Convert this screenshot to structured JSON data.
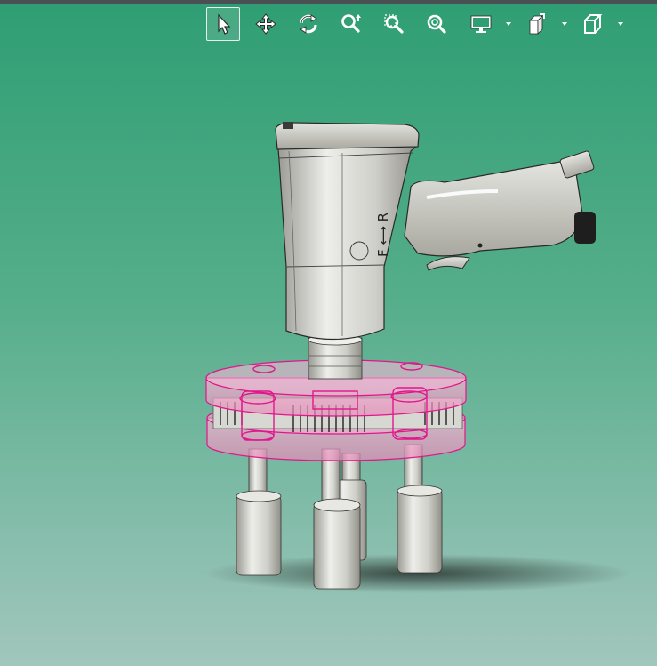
{
  "toolbar": {
    "tools": [
      {
        "name": "select",
        "icon": "select-arrow-icon",
        "active": true
      },
      {
        "name": "pan",
        "icon": "pan-arrows-icon",
        "active": false
      },
      {
        "name": "rotate",
        "icon": "rotate-icon",
        "active": false
      },
      {
        "name": "zoom-dynamic",
        "icon": "zoom-dynamic-icon",
        "active": false
      },
      {
        "name": "zoom-window",
        "icon": "zoom-window-icon",
        "active": false
      },
      {
        "name": "zoom-fit",
        "icon": "zoom-fit-icon",
        "active": false
      },
      {
        "name": "display-mode",
        "icon": "monitor-icon",
        "has_dropdown": true
      },
      {
        "name": "view-orientation",
        "icon": "view-cube-stack-icon",
        "has_dropdown": true
      },
      {
        "name": "view-cube",
        "icon": "cube-icon",
        "has_dropdown": true
      }
    ]
  },
  "viewport": {
    "model_label": "F ⟷ R",
    "background_top": "#2f9e73",
    "background_bottom": "#a2c6bd",
    "highlight_color": "#e0178a"
  }
}
